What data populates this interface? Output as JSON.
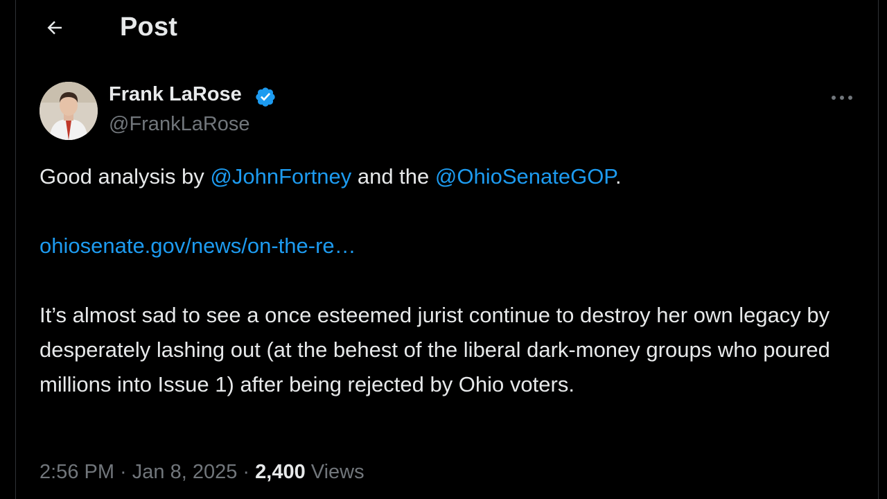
{
  "header": {
    "back_icon": "arrow-left-icon",
    "title": "Post"
  },
  "author": {
    "avatar_icon": "profile-photo",
    "name": "Frank LaRose",
    "verified_icon": "verified-badge-icon",
    "handle": "@FrankLaRose"
  },
  "more_icon": "more-horizontal-icon",
  "tweet": {
    "line1_before": "Good analysis by ",
    "mention1": "@JohnFortney",
    "line1_middle": " and the ",
    "mention2": "@OhioSenateGOP",
    "line1_after": ".",
    "url": "ohiosenate.gov/news/on-the-re…",
    "body": "It’s almost sad to see a once esteemed jurist continue to destroy her own legacy by desperately lashing out (at the behest of the liberal dark-money groups who poured millions into Issue 1) after being rejected by Ohio voters."
  },
  "meta": {
    "time": "2:56 PM",
    "separator1": " · ",
    "date": "Jan 8, 2025",
    "separator2": " · ",
    "views_count": "2,400",
    "views_label": " Views"
  },
  "colors": {
    "background": "#000000",
    "text": "#e7e9ea",
    "secondary": "#71767b",
    "link": "#1d9bf0",
    "verified": "#1d9bf0"
  }
}
